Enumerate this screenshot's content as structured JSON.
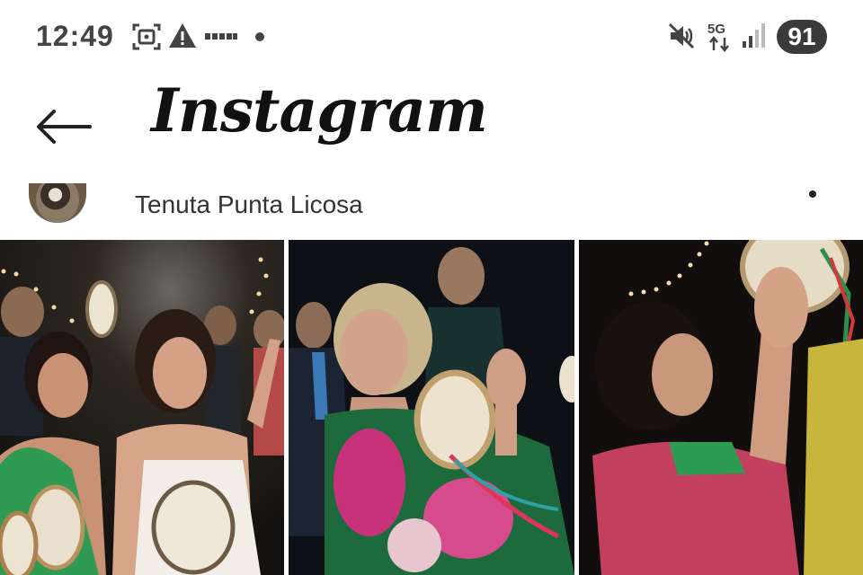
{
  "status_bar": {
    "time": "12:49",
    "battery": "91",
    "network": "5G",
    "icons": [
      "screenshot-icon",
      "warning-icon",
      "more-notifications-icon",
      "dot-icon",
      "mute-icon",
      "network-icon",
      "signal-icon"
    ]
  },
  "header": {
    "back_icon": "arrow-left-icon",
    "logo_text": "Instagram"
  },
  "location": {
    "name": "Tenuta Punta Licosa",
    "more_icon": "dot-icon"
  },
  "grid": {
    "photos": [
      {
        "name": "photo-1"
      },
      {
        "name": "photo-2"
      },
      {
        "name": "photo-3"
      }
    ]
  }
}
